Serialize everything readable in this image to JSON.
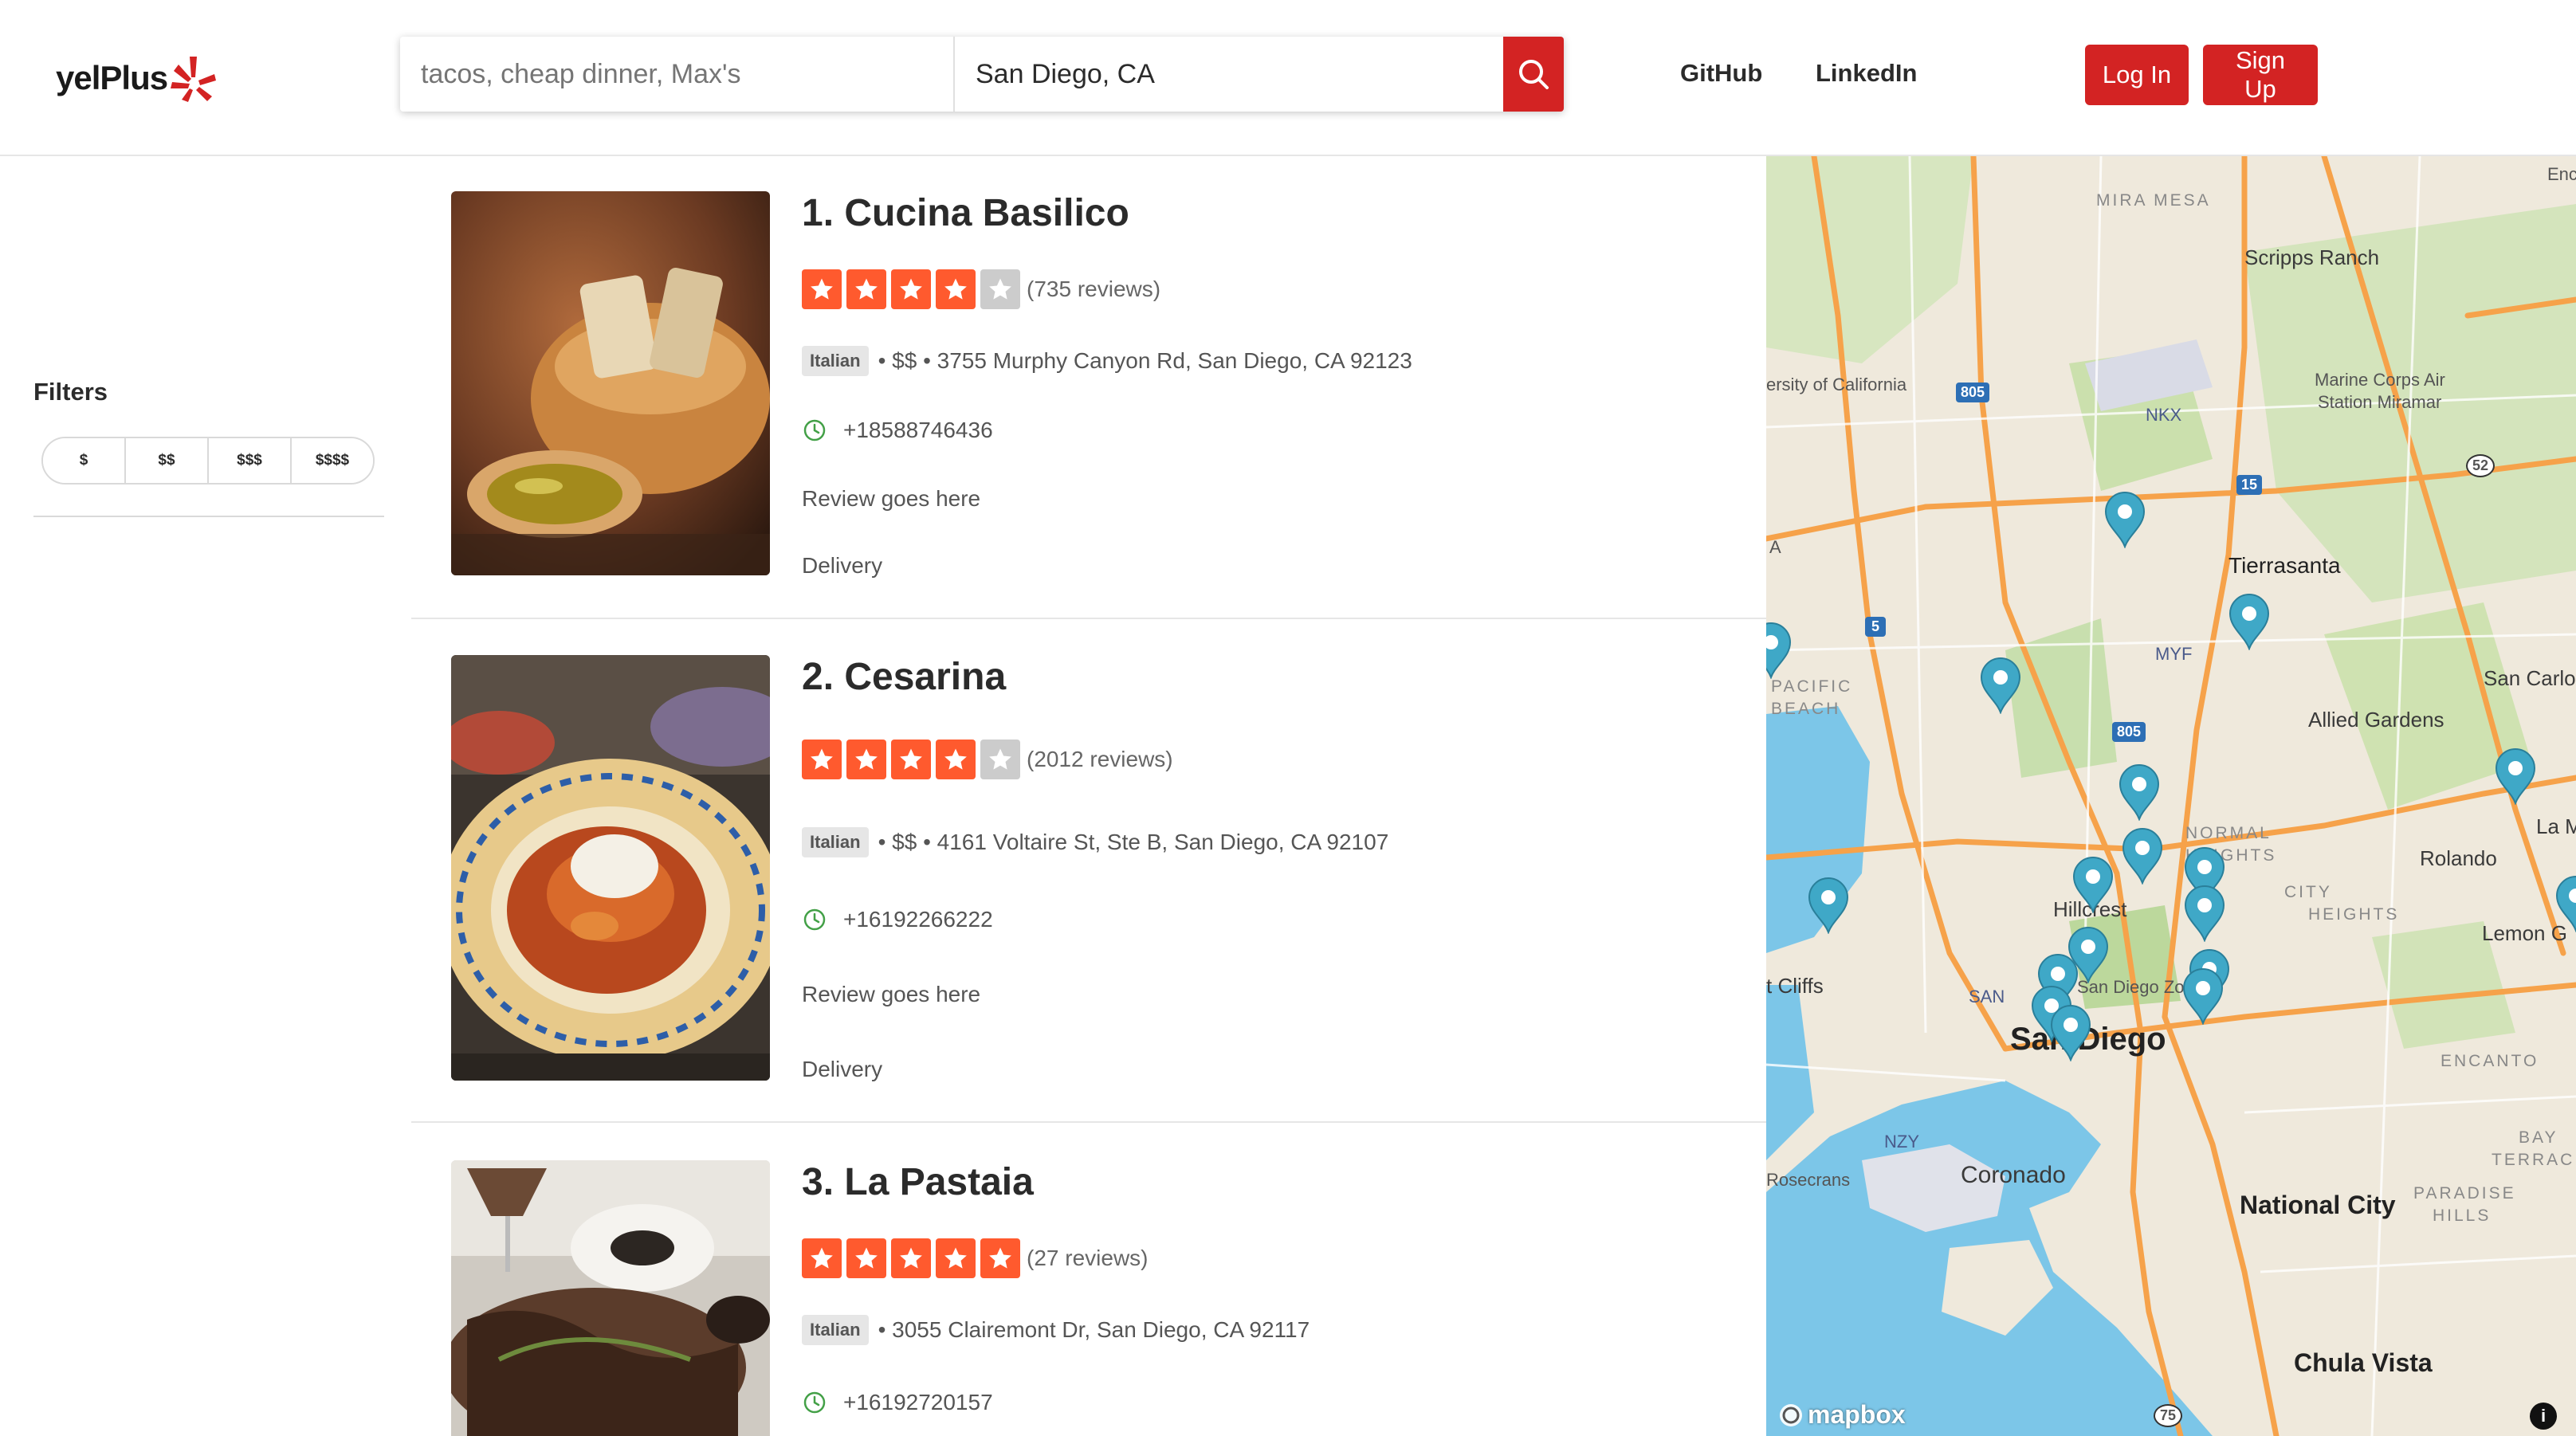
{
  "brand": {
    "name": "yelPlus",
    "accent": "#d32323"
  },
  "search": {
    "find_placeholder": "tacos, cheap dinner, Max's",
    "near_value": "San Diego, CA",
    "near_placeholder": "San Diego, CA",
    "button_icon": "search-icon"
  },
  "nav": {
    "github": "GitHub",
    "linkedin": "LinkedIn",
    "login": "Log In",
    "signup": "Sign Up"
  },
  "filters": {
    "title": "Filters",
    "prices": [
      "$",
      "$$",
      "$$$",
      "$$$$"
    ]
  },
  "results": [
    {
      "title": "1. Cucina Basilico",
      "rating": 4,
      "reviews": "(735 reviews)",
      "category": "Italian",
      "details": "• $$ • 3755 Murphy Canyon Rd, San Diego, CA 92123",
      "phone": "+18588746436",
      "review": "Review goes here",
      "transactions": "Delivery"
    },
    {
      "title": "2. Cesarina",
      "rating": 4,
      "reviews": "(2012 reviews)",
      "category": "Italian",
      "details": "• $$ • 4161 Voltaire St, Ste B, San Diego, CA 92107",
      "phone": "+16192266222",
      "review": "Review goes here",
      "transactions": "Delivery"
    },
    {
      "title": "3. La Pastaia",
      "rating": 5,
      "reviews": "(27 reviews)",
      "category": "Italian",
      "details": "• 3055 Clairemont Dr, San Diego, CA 92117",
      "phone": "+16192720157"
    }
  ],
  "map": {
    "labels": {
      "mira_mesa": "MIRA MESA",
      "scripps_ranch": "Scripps Ranch",
      "university": "ersity of California",
      "mcas": "Marine Corps Air",
      "mcas2": "Station Miramar",
      "nkx": "NKX",
      "tierrasanta": "Tierrasanta",
      "myf": "MYF",
      "pacific_beach": "PACIFIC",
      "pacific_beach2": "BEACH",
      "allied_gardens": "Allied Gardens",
      "san_carlos": "San Carlos",
      "la": "La M",
      "normal_heights": "NORMAL",
      "normal_heights2": "HEIGHTS",
      "rolando": "Rolando",
      "city_heights": "CITY",
      "city_heights2": "HEIGHTS",
      "hillcrest": "Hillcrest",
      "lemon_grove": "Lemon G",
      "cliffs": "t Cliffs",
      "san": "SAN",
      "zoo": "San Diego Zoo",
      "san_diego": "San Diego",
      "encanto": "ENCANTO",
      "nzy": "NZY",
      "bay_terraces": "BAY",
      "bay_terraces2": "TERRACES",
      "rosecrans": "Rosecrans",
      "coronado": "Coronado",
      "national_city": "National City",
      "paradise_hills": "PARADISE",
      "paradise_hills2": "HILLS",
      "chula_vista": "Chula Vista",
      "enc": "Enca",
      "hwy_805": "805",
      "hwy_15": "15",
      "hwy_5": "5",
      "hwy_52": "52",
      "hwy_75": "75",
      "a": "A"
    },
    "attribution": "mapbox",
    "info_icon": "i"
  },
  "colors": {
    "star_on": "#ff5a2e",
    "star_off": "#cccccc",
    "phone_icon": "#43a047",
    "pin": "#3fa8c7",
    "water": "#7cc6e8",
    "park": "#c8dfae",
    "road": "#f6a24a"
  }
}
